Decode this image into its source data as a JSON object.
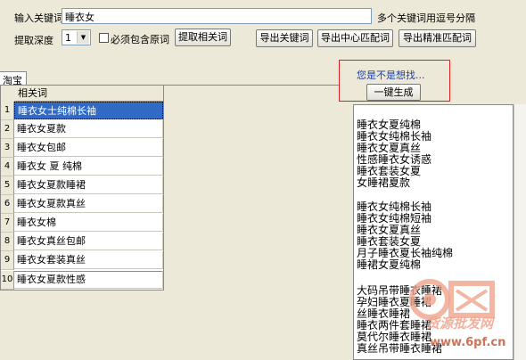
{
  "toolbar": {
    "keyword_label": "输入关键词",
    "keyword_value": "睡衣女",
    "hint": "多个关键词用逗号分隔",
    "depth_label": "提取深度",
    "depth_value": "1",
    "checkbox_label": "必须包含原词",
    "fetch_button": "提取相关词",
    "export_keywords": "导出关键词",
    "export_center": "导出中心匹配词",
    "export_exact": "导出精准匹配词"
  },
  "tab": {
    "label": "淘宝"
  },
  "grid": {
    "header": "相关词",
    "rows": [
      {
        "num": "1",
        "text": "睡衣女士纯棉长袖"
      },
      {
        "num": "2",
        "text": "睡衣女夏款"
      },
      {
        "num": "3",
        "text": "睡衣女包邮"
      },
      {
        "num": "4",
        "text": "睡衣女 夏 纯棉"
      },
      {
        "num": "5",
        "text": "睡衣女夏款睡裙"
      },
      {
        "num": "6",
        "text": "睡衣女夏款真丝"
      },
      {
        "num": "7",
        "text": "睡衣女棉"
      },
      {
        "num": "8",
        "text": "睡衣女真丝包邮"
      },
      {
        "num": "9",
        "text": "睡衣女套装真丝"
      },
      {
        "num": "10",
        "text": "睡衣女夏款性感"
      }
    ]
  },
  "suggest": {
    "label": "您是不是想找...",
    "generate_button": "一键生成"
  },
  "results": {
    "group1": [
      "睡衣女夏纯棉",
      "睡衣女纯棉长袖",
      "睡衣女夏真丝",
      "性感睡衣女诱惑",
      "睡衣套装女夏",
      "女睡裙夏款"
    ],
    "group2": [
      "睡衣女纯棉长袖",
      "睡衣女纯棉短袖",
      "睡衣女夏真丝",
      "睡衣套装女夏",
      "月子睡衣夏长袖纯棉",
      "睡裙女夏纯棉"
    ],
    "group3": [
      "大码吊带睡衣睡裙",
      "孕妇睡衣夏睡裙",
      "丝睡衣睡裙",
      "睡衣两件套睡裙",
      "莫代尔睡衣睡裙",
      "真丝吊带睡衣睡裙"
    ]
  },
  "watermark": {
    "text1": "货源批发网",
    "text2": "www.6pf.cn"
  },
  "colors": {
    "selection": "#316ac5",
    "highlight_box": "#e02020",
    "suggest_text": "#1a3fa6"
  }
}
